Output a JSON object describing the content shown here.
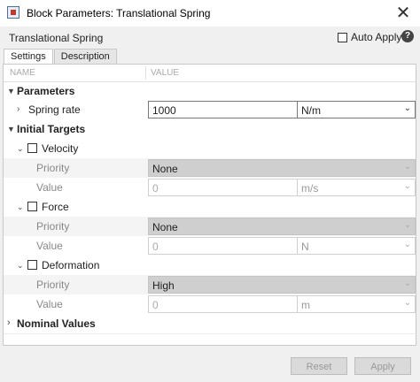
{
  "window": {
    "title": "Block Parameters: Translational Spring",
    "close_glyph": "✕"
  },
  "header": {
    "block_name": "Translational Spring",
    "auto_apply_label": "Auto Apply",
    "auto_apply_checked": false,
    "help_glyph": "?"
  },
  "tabs": [
    {
      "label": "Settings",
      "active": true
    },
    {
      "label": "Description",
      "active": false
    }
  ],
  "columns": {
    "name": "NAME",
    "value": "VALUE"
  },
  "parameters": {
    "label": "Parameters",
    "spring_rate": {
      "label": "Spring rate",
      "value": "1000",
      "unit": "N/m"
    }
  },
  "initial_targets": {
    "label": "Initial Targets",
    "velocity": {
      "label": "Velocity",
      "checked": false,
      "priority_label": "Priority",
      "priority": "None",
      "value_label": "Value",
      "value": "0",
      "unit": "m/s"
    },
    "force": {
      "label": "Force",
      "checked": false,
      "priority_label": "Priority",
      "priority": "None",
      "value_label": "Value",
      "value": "0",
      "unit": "N"
    },
    "deformation": {
      "label": "Deformation",
      "checked": false,
      "priority_label": "Priority",
      "priority": "High",
      "value_label": "Value",
      "value": "0",
      "unit": "m"
    }
  },
  "nominal_values": {
    "label": "Nominal Values"
  },
  "footer": {
    "reset_label": "Reset",
    "apply_label": "Apply"
  },
  "colors": {
    "disabled_combo": "#cfcfcf",
    "accent_icon": "#c0392b"
  }
}
